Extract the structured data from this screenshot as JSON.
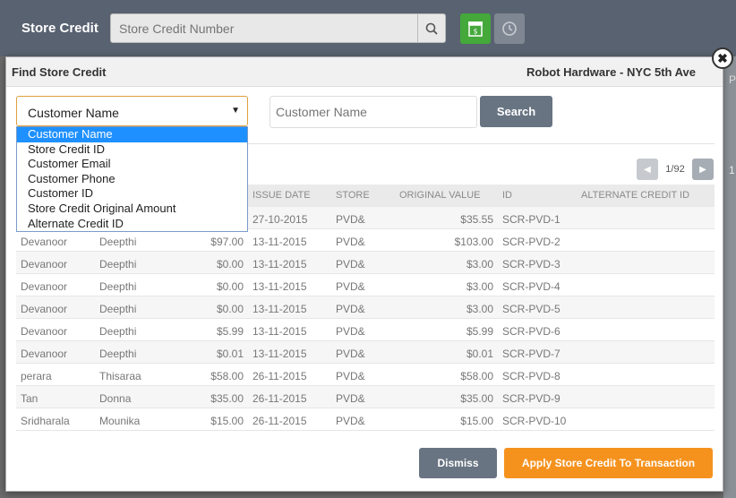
{
  "topbar": {
    "title": "Store Credit",
    "search_placeholder": "Store Credit Number"
  },
  "background": {
    "col_fragment": "P",
    "row_fragment": "1"
  },
  "dialog": {
    "title": "Find Store Credit",
    "store_name": "Robot Hardware - NYC 5th Ave",
    "close_glyph": "✖"
  },
  "filter": {
    "selected": "Customer Name",
    "options": [
      "Customer Name",
      "Store Credit ID",
      "Customer Email",
      "Customer Phone",
      "Customer ID",
      "Store Credit Original Amount",
      "Alternate Credit ID"
    ],
    "input_placeholder": "Customer Name",
    "search_label": "Search"
  },
  "pager": {
    "page_label": "1/92"
  },
  "table": {
    "headers": [
      "",
      "",
      "",
      "ISSUE DATE",
      "STORE",
      "ORIGINAL VALUE",
      "ID",
      "ALTERNATE CREDIT ID"
    ],
    "rows": [
      [
        "",
        "",
        "",
        "27-10-2015",
        "PVD&",
        "$35.55",
        "SCR-PVD-1",
        ""
      ],
      [
        "Devanoor",
        "Deepthi",
        "$97.00",
        "13-11-2015",
        "PVD&",
        "$103.00",
        "SCR-PVD-2",
        ""
      ],
      [
        "Devanoor",
        "Deepthi",
        "$0.00",
        "13-11-2015",
        "PVD&",
        "$3.00",
        "SCR-PVD-3",
        ""
      ],
      [
        "Devanoor",
        "Deepthi",
        "$0.00",
        "13-11-2015",
        "PVD&",
        "$3.00",
        "SCR-PVD-4",
        ""
      ],
      [
        "Devanoor",
        "Deepthi",
        "$0.00",
        "13-11-2015",
        "PVD&",
        "$3.00",
        "SCR-PVD-5",
        ""
      ],
      [
        "Devanoor",
        "Deepthi",
        "$5.99",
        "13-11-2015",
        "PVD&",
        "$5.99",
        "SCR-PVD-6",
        ""
      ],
      [
        "Devanoor",
        "Deepthi",
        "$0.01",
        "13-11-2015",
        "PVD&",
        "$0.01",
        "SCR-PVD-7",
        ""
      ],
      [
        "perara",
        "Thisaraa",
        "$58.00",
        "26-11-2015",
        "PVD&",
        "$58.00",
        "SCR-PVD-8",
        ""
      ],
      [
        "Tan",
        "Donna",
        "$35.00",
        "26-11-2015",
        "PVD&",
        "$35.00",
        "SCR-PVD-9",
        ""
      ],
      [
        "Sridharala",
        "Mounika",
        "$15.00",
        "26-11-2015",
        "PVD&",
        "$15.00",
        "SCR-PVD-10",
        ""
      ]
    ]
  },
  "footer": {
    "dismiss_label": "Dismiss",
    "apply_label": "Apply Store Credit To Transaction"
  },
  "colors": {
    "primary_button": "#687482",
    "accent": "#f5921e",
    "store_icon": "#45a83b",
    "selection": "#1e90ff"
  }
}
